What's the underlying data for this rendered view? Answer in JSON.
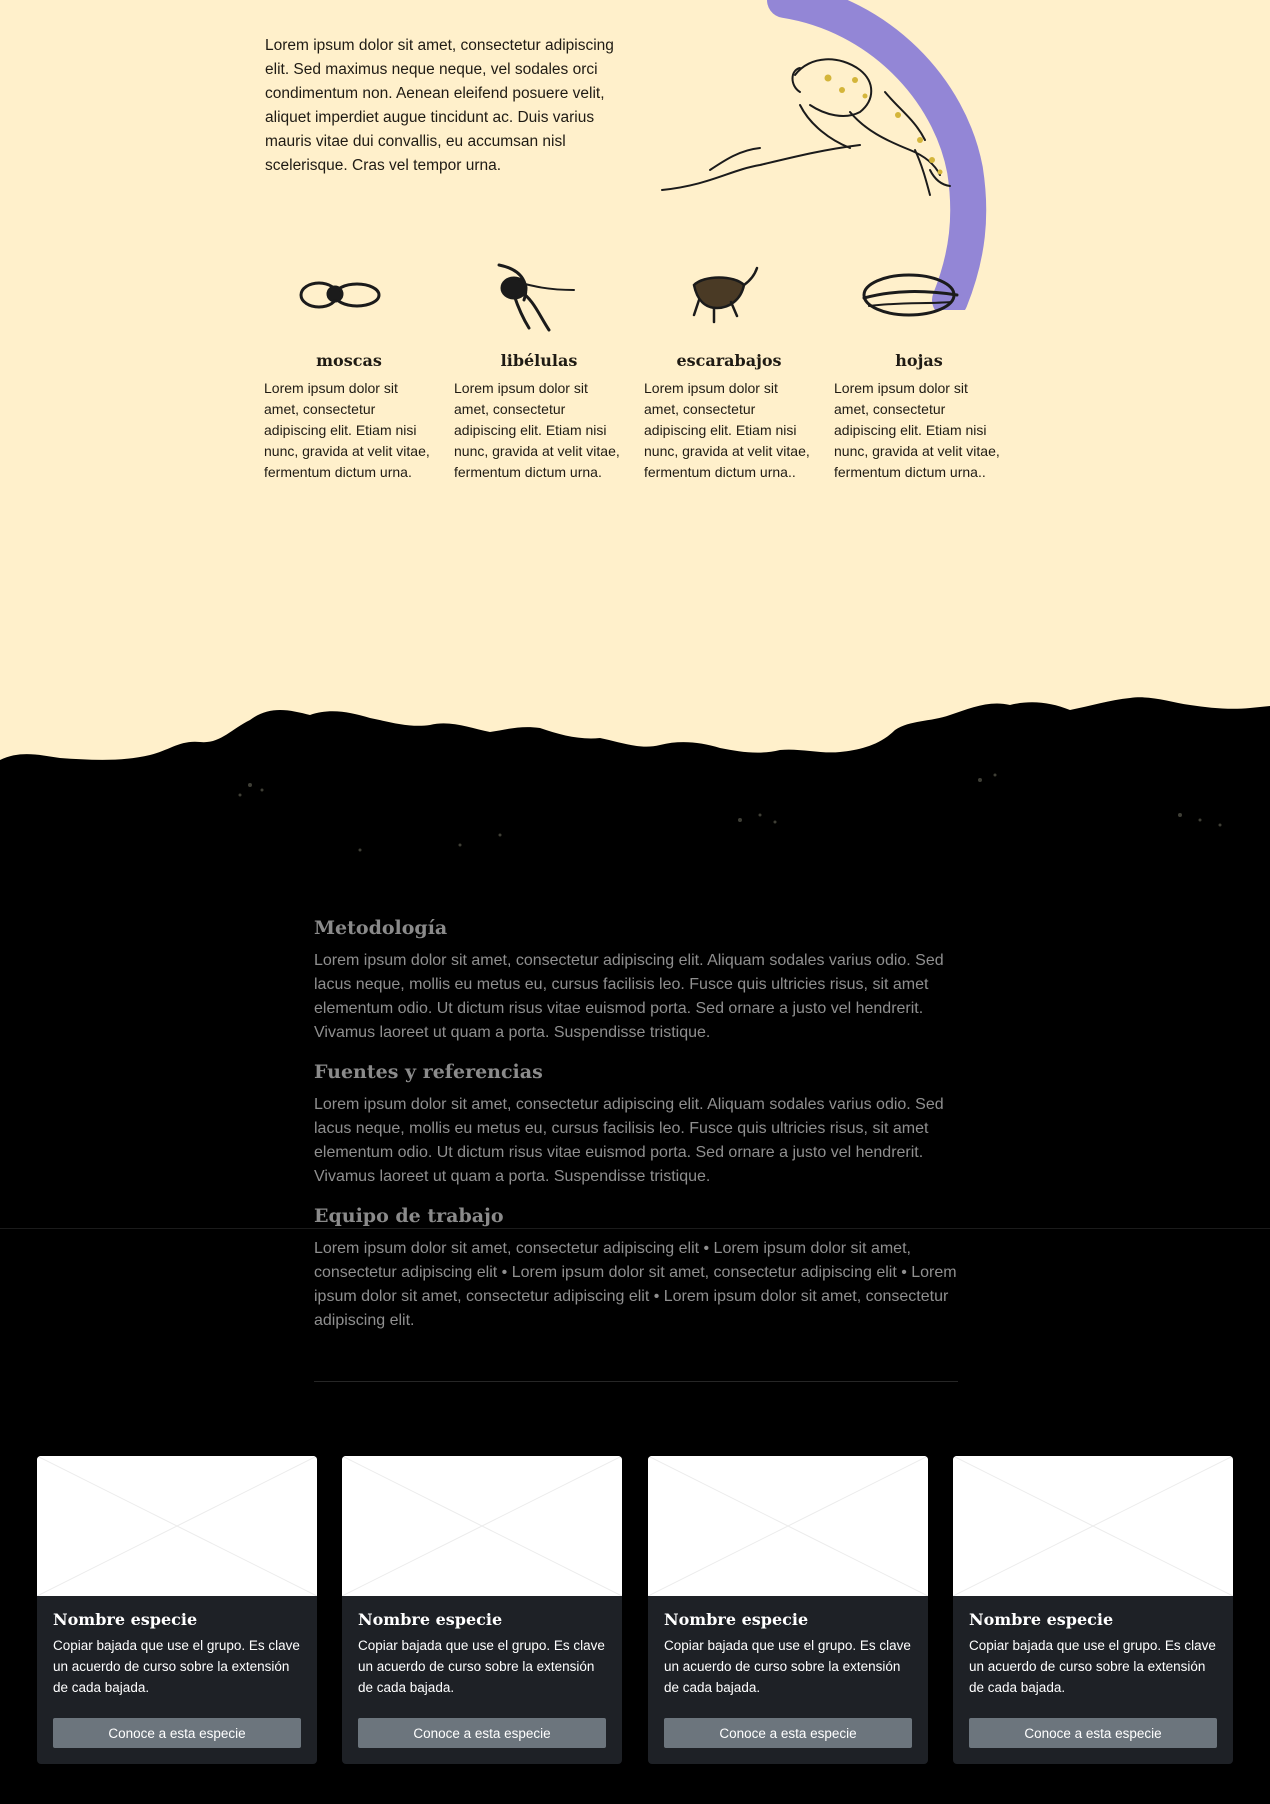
{
  "intro": {
    "text": "Lorem ipsum dolor sit amet, consectetur adipiscing elit. Sed maximus neque neque, vel sodales orci condimentum non. Aenean eleifend posuere velit, aliquet imperdiet augue tincidunt ac. Duis varius mauris vitae dui convallis, eu accumsan nisl scelerisque. Cras vel tempor urna."
  },
  "diet": [
    {
      "title": "moscas",
      "text": "Lorem ipsum dolor sit amet, consectetur adipiscing elit. Etiam nisi nunc, gravida at velit vitae, fermentum dictum urna.",
      "icon": "fly-icon"
    },
    {
      "title": "libélulas",
      "text": "Lorem ipsum dolor sit amet, consectetur adipiscing elit. Etiam nisi nunc, gravida at velit vitae, fermentum dictum urna.",
      "icon": "dragonfly-icon"
    },
    {
      "title": "escarabajos",
      "text": "Lorem ipsum dolor sit amet, consectetur adipiscing elit. Etiam nisi nunc, gravida at velit vitae, fermentum dictum urna..",
      "icon": "beetle-icon"
    },
    {
      "title": "hojas",
      "text": "Lorem ipsum dolor sit amet, consectetur adipiscing elit. Etiam nisi nunc, gravida at velit vitae, fermentum dictum urna..",
      "icon": "leaf-icon"
    }
  ],
  "sections": [
    {
      "title": "Metodología",
      "text": "Lorem ipsum dolor sit amet, consectetur adipiscing elit. Aliquam sodales varius odio. Sed lacus neque, mollis eu metus eu, cursus facilisis leo. Fusce quis ultricies risus, sit amet elementum odio. Ut dictum risus vitae euismod porta. Sed ornare a justo vel hendrerit. Vivamus laoreet ut quam a porta. Suspendisse tristique."
    },
    {
      "title": "Fuentes y referencias",
      "text": "Lorem ipsum dolor sit amet, consectetur adipiscing elit. Aliquam sodales varius odio. Sed lacus neque, mollis eu metus eu, cursus facilisis leo. Fusce quis ultricies risus, sit amet elementum odio. Ut dictum risus vitae euismod porta. Sed ornare a justo vel hendrerit. Vivamus laoreet ut quam a porta. Suspendisse tristique."
    },
    {
      "title": "Equipo de trabajo",
      "text": "Lorem ipsum dolor sit amet, consectetur adipiscing elit • Lorem ipsum dolor sit amet, consectetur adipiscing elit • Lorem ipsum dolor sit amet, consectetur adipiscing elit • Lorem ipsum dolor sit amet, consectetur adipiscing elit • Lorem ipsum dolor sit amet, consectetur adipiscing elit."
    }
  ],
  "cards": [
    {
      "title": "Nombre especie",
      "text": "Copiar bajada que use el grupo. Es clave un acuerdo de curso sobre la extensión de cada bajada.",
      "button": "Conoce a esta especie"
    },
    {
      "title": "Nombre especie",
      "text": "Copiar bajada que use el grupo. Es clave un acuerdo de curso sobre la extensión de cada bajada.",
      "button": "Conoce a esta especie"
    },
    {
      "title": "Nombre especie",
      "text": "Copiar bajada que use el grupo. Es clave un acuerdo de curso sobre la extensión de cada bajada.",
      "button": "Conoce a esta especie"
    },
    {
      "title": "Nombre especie",
      "text": "Copiar bajada que use el grupo. Es clave un acuerdo de curso sobre la extensión de cada bajada.",
      "button": "Conoce a esta especie"
    }
  ],
  "colors": {
    "background_top": "#fff0cb",
    "accent_stroke": "#8d7fd6",
    "background_bottom": "#000000",
    "card_background": "#1e2126",
    "button_background": "#6c757d"
  }
}
